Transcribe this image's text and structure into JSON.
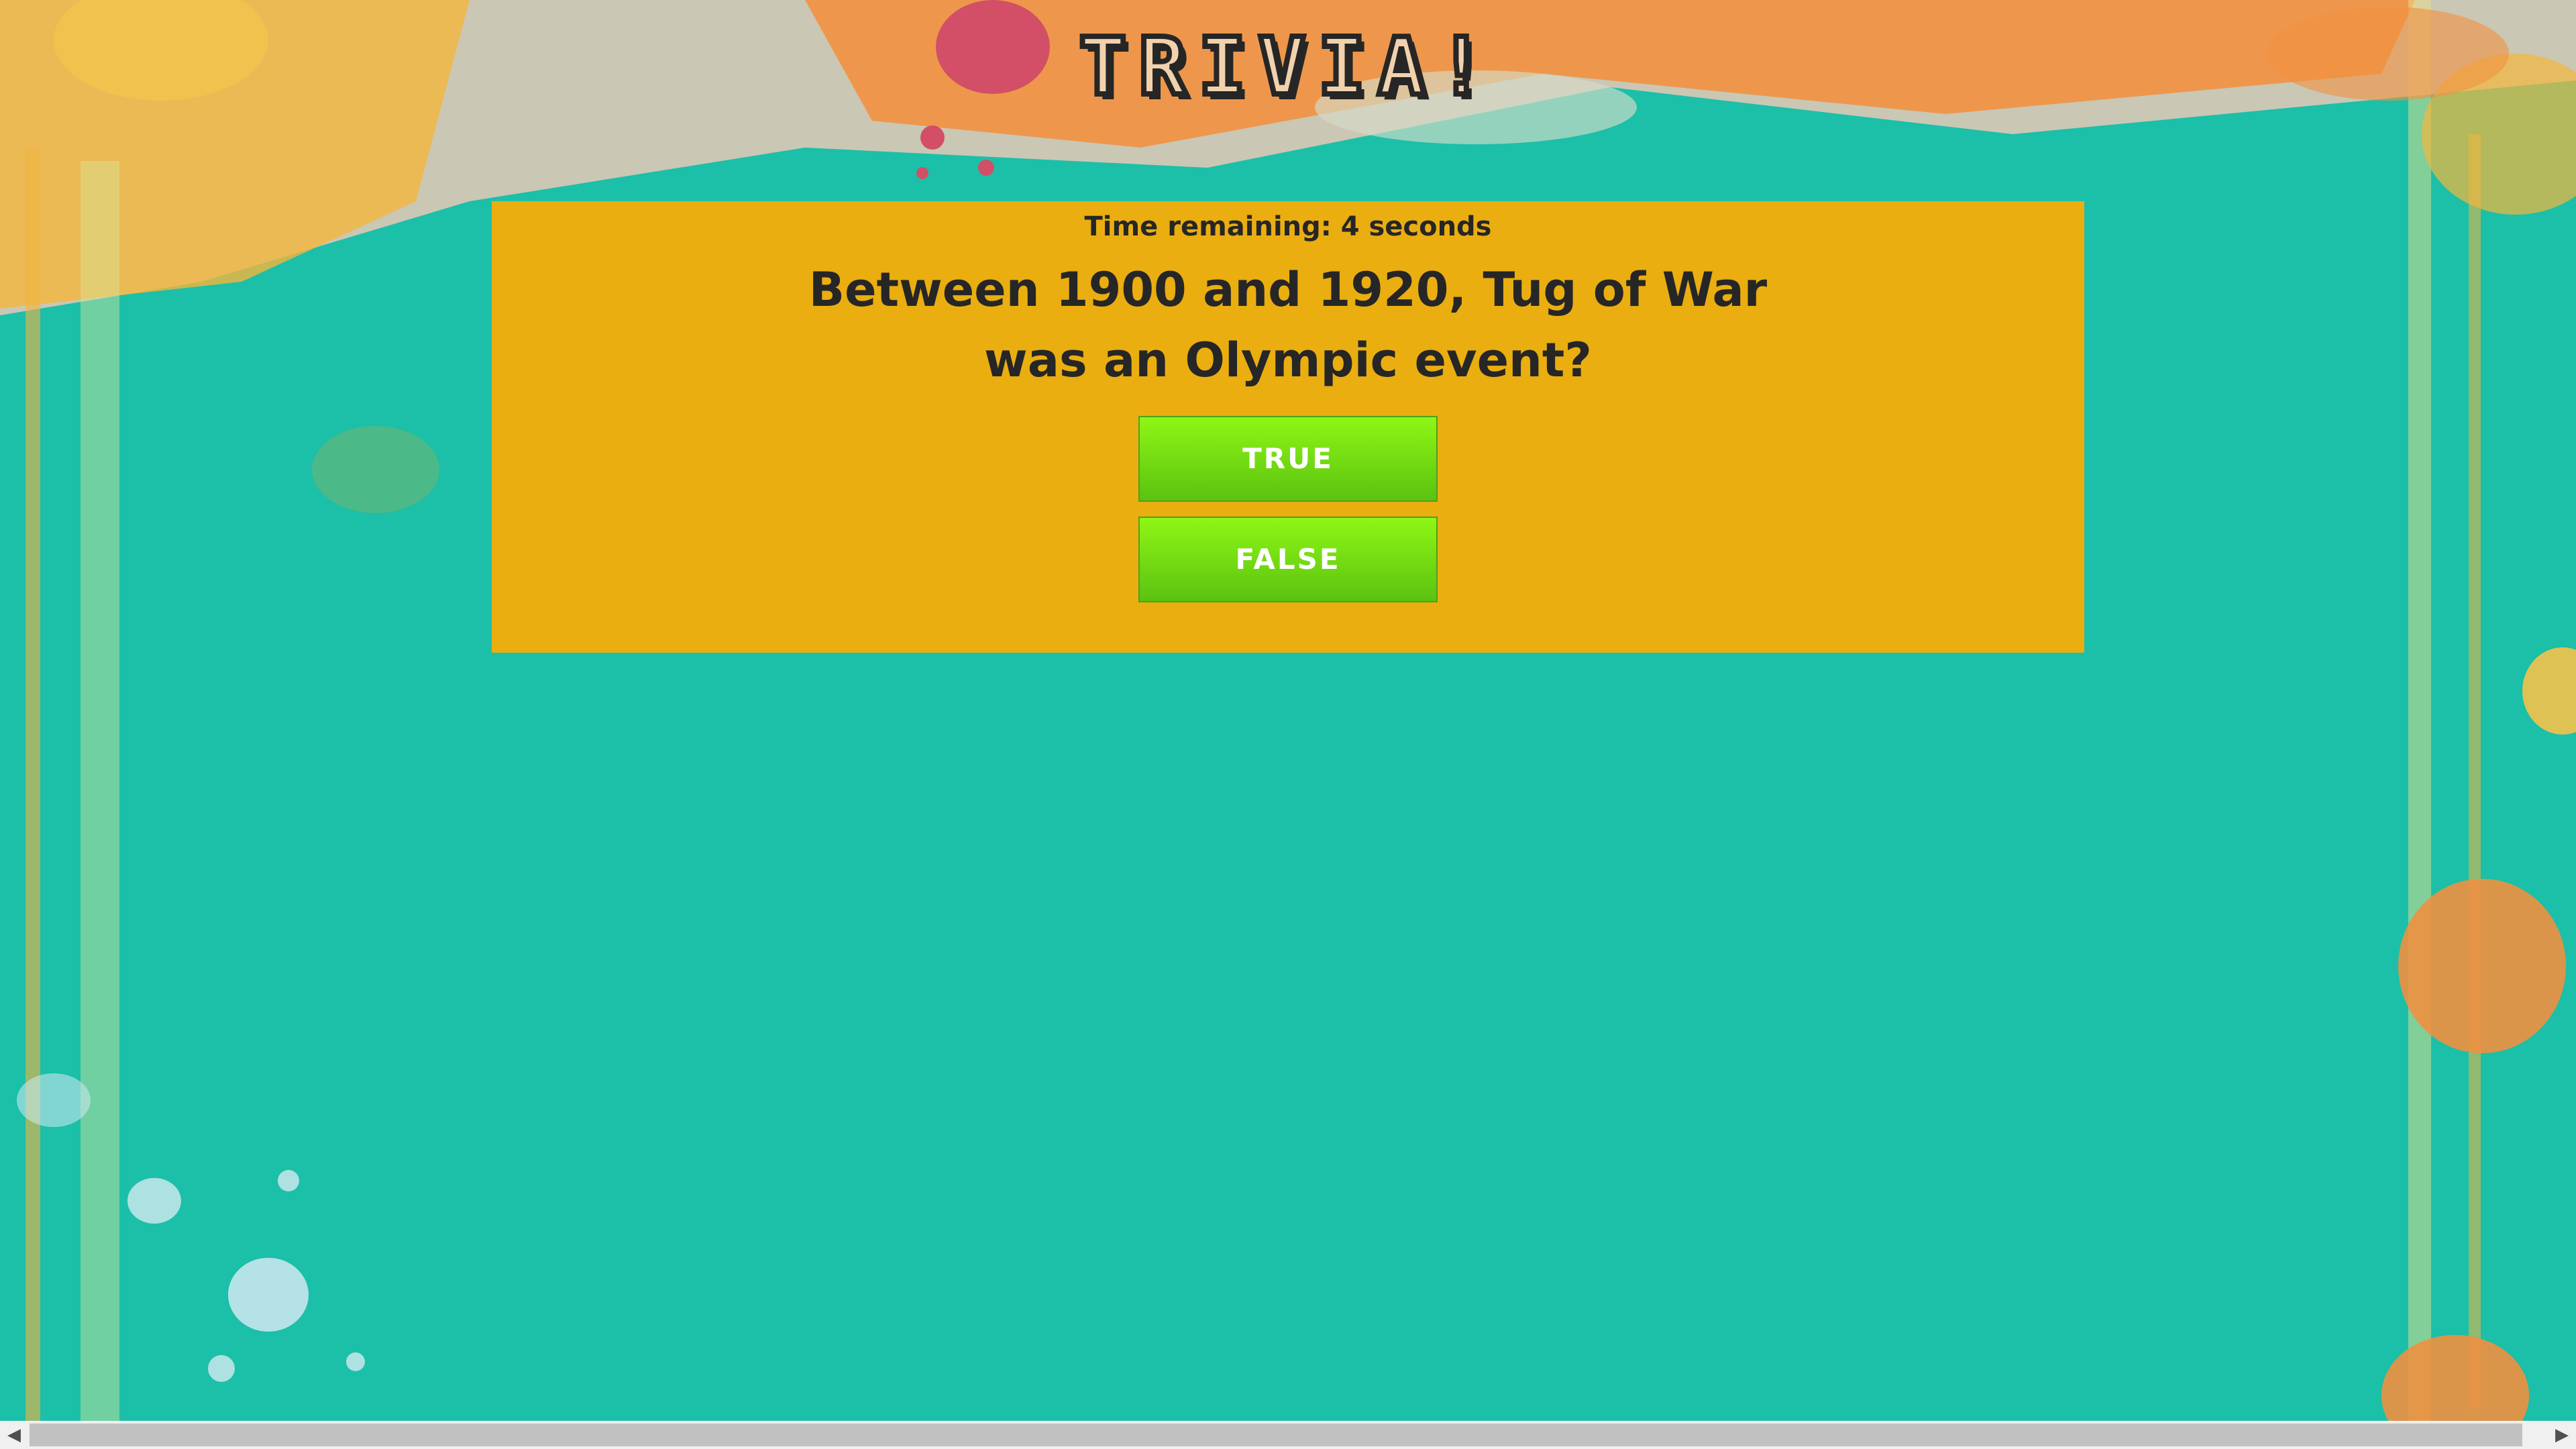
{
  "game": {
    "title": "TRIVIA!",
    "timer_text": "Time remaining: 4 seconds",
    "question": "Between 1900 and 1920, Tug of War was an Olympic event?",
    "answers": {
      "true_label": "TRUE",
      "false_label": "FALSE"
    }
  },
  "colors": {
    "background": "#1cbfa8",
    "card": "#eaae10",
    "button": "#7ee014",
    "title_fill": "#f1d2ad",
    "text": "#262626"
  },
  "icons": {
    "scroll_left": "chevron-left-icon",
    "scroll_right": "chevron-right-icon"
  }
}
